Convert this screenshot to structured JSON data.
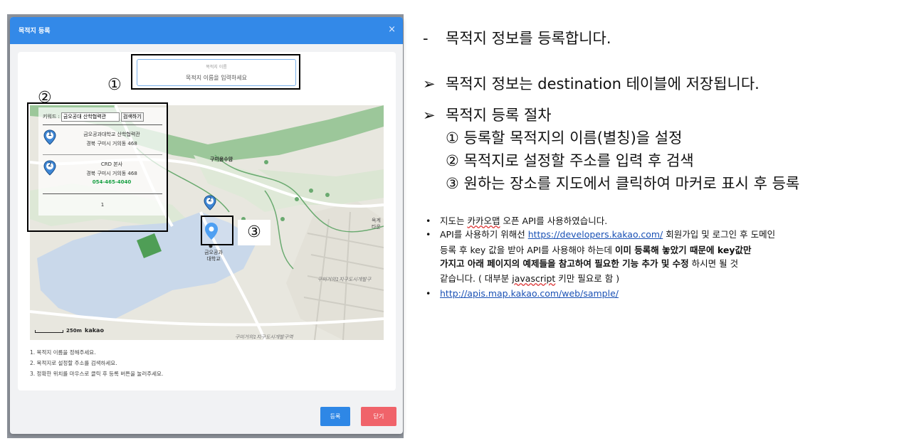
{
  "modal": {
    "title": "목적지 등록",
    "close_icon": "×",
    "name_label": "목적지 이름",
    "name_placeholder": "목적지 이름을 입력하세요",
    "search": {
      "keyword_label": "키워드 :",
      "keyword_value": "금오공대 산학협력관",
      "search_button": "검색하기",
      "results": [
        {
          "marker": "1",
          "title": "금오공과대학교 산학협력관",
          "address": "경북 구미시 거의동 468",
          "phone": ""
        },
        {
          "marker": "2",
          "title": "CRD 본사",
          "address": "경북 구미시 거의동 468",
          "phone": "054-465-4040"
        }
      ],
      "page": "1"
    },
    "map": {
      "labels": {
        "reservoir": "구미용수암",
        "university": "금오공과\n대학교",
        "right_edge": "옥계\n타운",
        "district1": "구미거의1지구도시개발구",
        "district2": "구미거의1지구도시개발구역"
      },
      "scale": "250m",
      "logo": "kakao",
      "marker_number": "2"
    },
    "annotations": {
      "c1": "①",
      "c2": "②",
      "c3": "③"
    },
    "instructions": [
      "1. 목적지 이름을 정해주세요.",
      "2. 목적지로 설정할 주소를 검색하세요.",
      "3. 정확한 위치를 마우스로 클릭 후 등록 버튼을 눌러주세요."
    ],
    "buttons": {
      "register": "등록",
      "close": "닫기"
    },
    "colors": {
      "header": "#3389e8",
      "register": "#2e87e6",
      "close": "#f0636a",
      "phone": "#18a043"
    }
  },
  "description": {
    "dash_glyph": "-",
    "arrow_glyph": "➢",
    "line1": "목적지 정보를 등록합니다.",
    "line2": "목적지 정보는 destination 테이블에 저장됩니다.",
    "line3": "목적지 등록 절차",
    "steps": [
      "① 등록할 목적지의 이름(별칭)을 설정",
      "② 목적지로 설정할 주소를 입력 후 검색",
      "③ 원하는 장소를 지도에서 클릭하여 마커로 표시 후 등록"
    ],
    "notes": {
      "bullet": "•",
      "n1_a": "지도는 ",
      "n1_b": "카카오맵",
      "n1_c": " 오픈 API를 사용하였습니다.",
      "n2_a": "API를 사용하기 위해선 ",
      "n2_link": "https://developers.kakao.com/",
      "n2_b": "  회원가입 및 로그인 후 도메인",
      "n2_line2_a": "등록 후 key 값을 받아 API를 사용해야 하는데 ",
      "n2_line2_b": "이미 등록해 놓았기 때문에 key값만",
      "n2_line3_a": "가지고 아래 페이지의 예제들을 참고하여 필요한 기능 추가 및 수정",
      "n2_line3_b": " 하시면 될 것",
      "n2_line4_a": "같습니다. ( 대부분 ",
      "n2_line4_b": "javascript",
      "n2_line4_c": " 키만 필요로 함 )",
      "n3_link": "http://apis.map.kakao.com/web/sample/"
    }
  }
}
